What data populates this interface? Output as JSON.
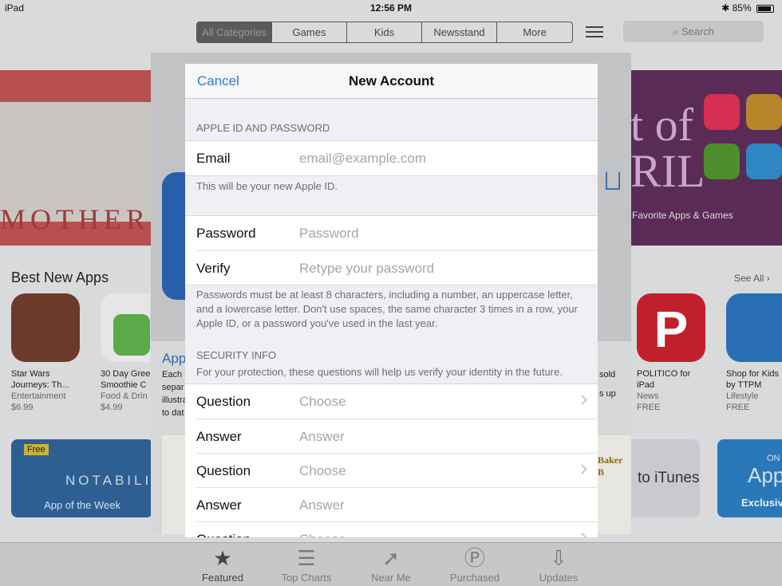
{
  "status": {
    "device": "iPad",
    "time": "12:56 PM",
    "battery": "85%"
  },
  "store": {
    "segments": [
      "All Categories",
      "Games",
      "Kids",
      "Newsstand",
      "More"
    ],
    "search_placeholder": "Search",
    "banner_left_text": "MOTHER'S",
    "banner_right_big": "t of\nRIL",
    "banner_right_tagline": "Favorite Apps & Games",
    "best_new_title": "Best New Apps",
    "see_all": "See All",
    "apps": [
      {
        "name": "Star Wars Journeys: Th...",
        "category": "Entertainment",
        "price": "$6.99",
        "color": "#6b3a2a"
      },
      {
        "name": "30 Day Gree Smoothie C",
        "category": "Food & Drin",
        "price": "$4.99",
        "color": "#5aaa4a"
      },
      {
        "name": "POLITICO for iPad",
        "category": "News",
        "price": "FREE",
        "color": "#c1202a"
      },
      {
        "name": "Shop for Kids by TTPM",
        "category": "Lifestyle",
        "price": "FREE",
        "color": "#2a6fb3"
      }
    ],
    "feature_left_badge": "Free",
    "feature_left_brand": "NOTABILIT",
    "feature_left_label": "App of the Week",
    "feature_mid_text": "to iTunes",
    "feature_right_text": "App",
    "feature_right_sub": "Exclusive",
    "feature_right_top": "ON",
    "tabs": [
      "Featured",
      "Top Charts",
      "Near Me",
      "Purchased",
      "Updates"
    ]
  },
  "detail": {
    "app_title": "App",
    "desc_lines": [
      "Each",
      "separ",
      "illustra",
      "to dat"
    ],
    "right_frags": [
      "sold",
      "s up"
    ],
    "book_title": "Baker B"
  },
  "modal": {
    "cancel": "Cancel",
    "title": "New Account",
    "section_apple_id": "APPLE ID AND PASSWORD",
    "email_label": "Email",
    "email_placeholder": "email@example.com",
    "email_note": "This will be your new Apple ID.",
    "password_label": "Password",
    "password_placeholder": "Password",
    "verify_label": "Verify",
    "verify_placeholder": "Retype your password",
    "password_note": "Passwords must be at least 8 characters, including a number, an uppercase letter, and a lowercase letter. Don't use spaces, the same character 3 times in a row, your Apple ID, or a password you've used in the last year.",
    "section_security": "SECURITY INFO",
    "security_note": "For your protection, these questions will help us verify your identity in the future.",
    "question_label": "Question",
    "question_value": "Choose",
    "answer_label": "Answer",
    "answer_placeholder": "Answer"
  }
}
